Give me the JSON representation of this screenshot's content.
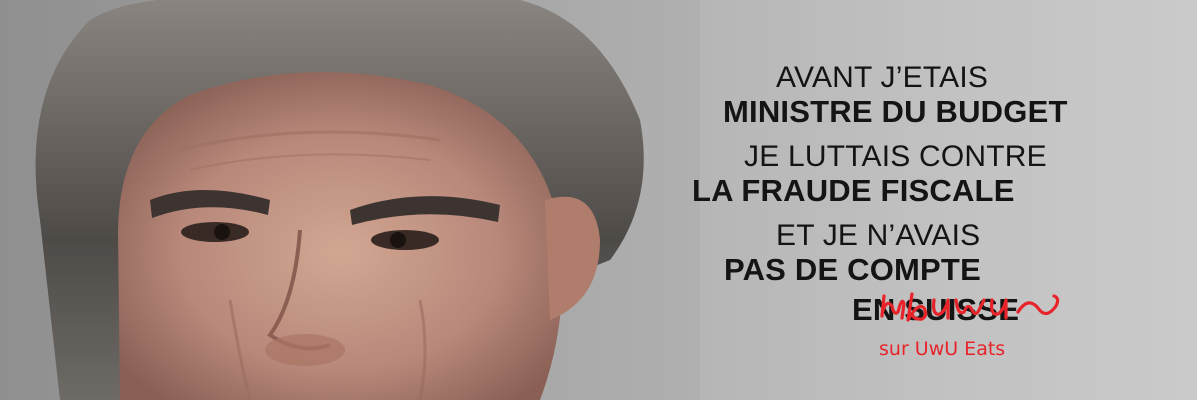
{
  "poster": {
    "lines": [
      "AVANT J’ETAIS",
      "MINISTRE DU BUDGET",
      "JE LUTTAIS CONTRE",
      "LA FRAUDE FISCALE",
      "ET JE N’AVAIS",
      "PAS DE COMPTE",
      "EN SUISSE"
    ]
  },
  "overlay": {
    "caption": "sur UwU Eats",
    "handwritten_word": "ubuwu",
    "color": "#e8232a"
  },
  "colors": {
    "text": "#141414",
    "background": "#b8b8b8"
  }
}
